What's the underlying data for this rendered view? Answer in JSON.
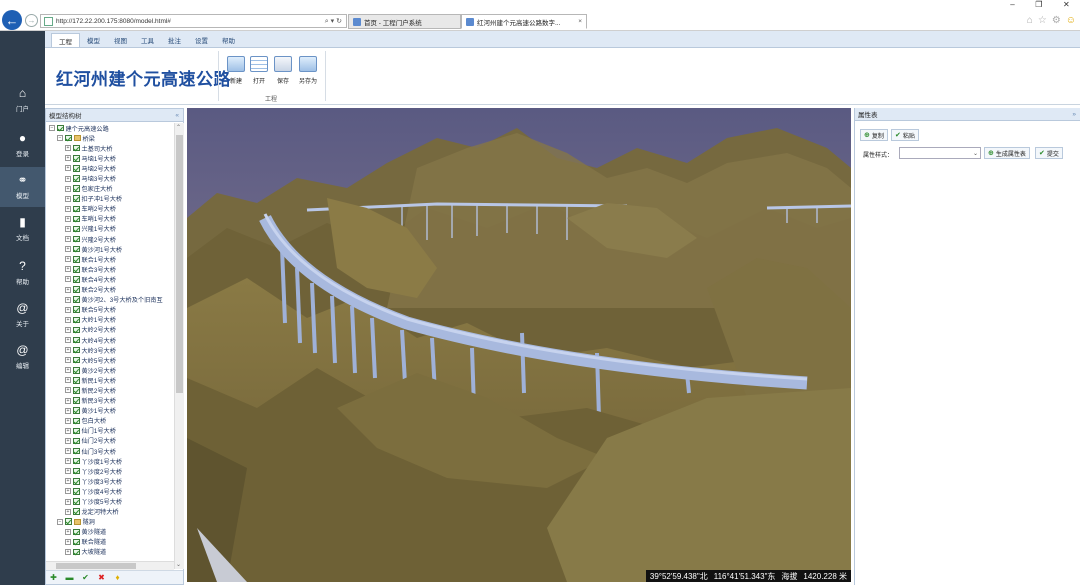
{
  "browser": {
    "url": "http://172.22.200.175:8080/model.html#",
    "tabs": [
      {
        "label": "首页 - 工程门户系统"
      },
      {
        "label": "红河州建个元高速公路数字...",
        "close": "×"
      }
    ]
  },
  "leftnav": {
    "items": [
      {
        "label": "门户",
        "icon": "home-icon"
      },
      {
        "label": "登录",
        "icon": "user-icon"
      },
      {
        "label": "模型",
        "icon": "model-icon"
      },
      {
        "label": "文档",
        "icon": "document-icon"
      },
      {
        "label": "帮助",
        "icon": "help-icon"
      },
      {
        "label": "关于",
        "icon": "at-icon"
      },
      {
        "label": "编辑",
        "icon": "at-icon"
      }
    ]
  },
  "ribbon": {
    "menu_tabs": [
      "工程",
      "模型",
      "视图",
      "工具",
      "批注",
      "设置",
      "帮助"
    ],
    "app_title": "红河州建个元高速公路",
    "buttons": [
      "新建",
      "打开",
      "保存",
      "另存为"
    ],
    "group_label": "工程"
  },
  "tree": {
    "title": "模型结构树",
    "collapse": "«",
    "root": "建个元高速公路",
    "group1": "桥梁",
    "bridges": [
      "土基司大桥",
      "马垴1号大桥",
      "马垴2号大桥",
      "马垴3号大桥",
      "包家庄大桥",
      "扣子冲1号大桥",
      "车哨2号大桥",
      "车哨1号大桥",
      "兴隆1号大桥",
      "兴隆2号大桥",
      "黄沙河1号大桥",
      "联合1号大桥",
      "联合3号大桥",
      "联合4号大桥",
      "联合2号大桥",
      "黄沙河2、3号大桥及个旧南互",
      "联合5号大桥",
      "大岭1号大桥",
      "大岭2号大桥",
      "大岭4号大桥",
      "大岭3号大桥",
      "大岭5号大桥",
      "黄沙2号大桥",
      "新民1号大桥",
      "新民2号大桥",
      "新民3号大桥",
      "黄沙1号大桥",
      "包白大桥",
      "仙门1号大桥",
      "仙门2号大桥",
      "仙门3号大桥",
      "丫沙度1号大桥",
      "丫沙度2号大桥",
      "丫沙度3号大桥",
      "丫沙度4号大桥",
      "丫沙度5号大桥",
      "龙定河特大桥"
    ],
    "group2": "隧洞",
    "tunnels": [
      "黄沙隧道",
      "联合隧道",
      "大坡隧道"
    ]
  },
  "viewport": {
    "status": {
      "lat": "39°52'59.438\"北",
      "lon": "116°41'51.343\"东",
      "alt_label": "海拔",
      "alt": "1420.228 米"
    }
  },
  "props": {
    "title": "属性表",
    "collapse": "»",
    "copy": "复制",
    "paste": "粘贴",
    "style_label": "属性样式：",
    "generate": "生成属性表",
    "submit": "提交"
  },
  "colors": {
    "nav_bg": "#2f3d4c",
    "accent": "#1f4fa0",
    "bridge": "#a8b9de",
    "terrain": "#7d6f3e",
    "sky": "#6f6a8a"
  }
}
